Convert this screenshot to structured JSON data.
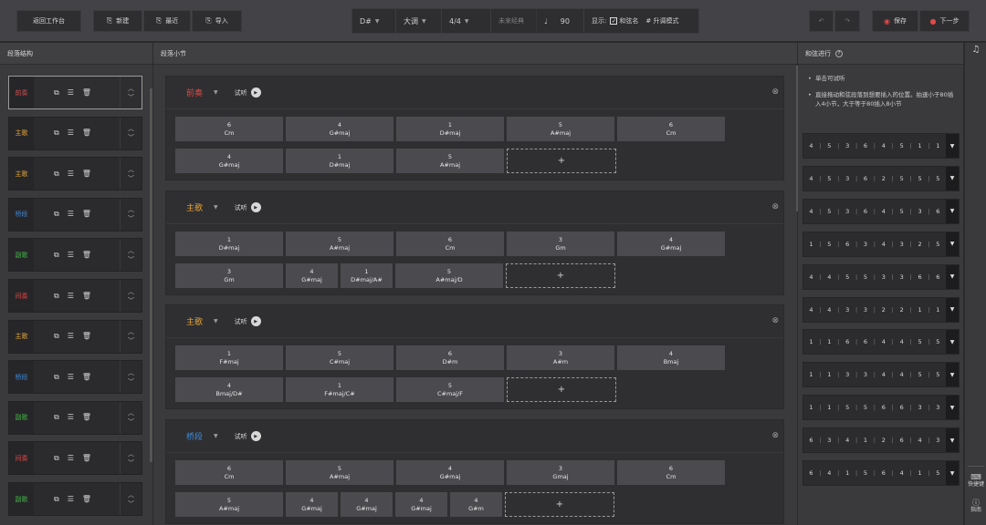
{
  "toolbar": {
    "back": "返回工作台",
    "new": "新建",
    "recent": "最近",
    "import": "导入",
    "key": "D#",
    "mode": "大调",
    "meter": "4/4",
    "rhythm": "未来经典",
    "note_icon": "♩",
    "bpm": "90",
    "show_label": "显示:",
    "chord_name": "和弦名",
    "sharp_mode": "# 升调模式",
    "save": "保存",
    "next": "下一步",
    "save_color": "#e04848"
  },
  "left_panel": {
    "title": "段落结构",
    "items": [
      {
        "name": "前奏",
        "color": "#e04848"
      },
      {
        "name": "主歌",
        "color": "#e6a53b"
      },
      {
        "name": "主歌",
        "color": "#e6a53b"
      },
      {
        "name": "桥段",
        "color": "#3f8ad8"
      },
      {
        "name": "副歌",
        "color": "#47b34a"
      },
      {
        "name": "间奏",
        "color": "#e04848"
      },
      {
        "name": "主歌",
        "color": "#e6a53b"
      },
      {
        "name": "桥段",
        "color": "#3f8ad8"
      },
      {
        "name": "副歌",
        "color": "#47b34a"
      },
      {
        "name": "间奏",
        "color": "#e04848"
      },
      {
        "name": "副歌",
        "color": "#47b34a"
      }
    ]
  },
  "middle_panel": {
    "title": "段落小节",
    "listen": "试听",
    "add": "+",
    "sections": [
      {
        "name": "前奏",
        "color": "#e04848",
        "rows": [
          [
            {
              "d": "6",
              "c": "Cm"
            },
            {
              "d": "4",
              "c": "G#maj"
            },
            {
              "d": "1",
              "c": "D#maj"
            },
            {
              "d": "5",
              "c": "A#maj"
            },
            {
              "d": "6",
              "c": "Cm"
            }
          ],
          [
            {
              "d": "4",
              "c": "G#maj"
            },
            {
              "d": "1",
              "c": "D#maj"
            },
            {
              "d": "5",
              "c": "A#maj"
            }
          ]
        ]
      },
      {
        "name": "主歌",
        "color": "#e6a53b",
        "rows": [
          [
            {
              "d": "1",
              "c": "D#maj"
            },
            {
              "d": "5",
              "c": "A#maj"
            },
            {
              "d": "6",
              "c": "Cm"
            },
            {
              "d": "3",
              "c": "Gm"
            },
            {
              "d": "4",
              "c": "G#maj"
            }
          ],
          [
            {
              "d": "3",
              "c": "Gm"
            },
            {
              "d": "4",
              "c": "G#maj",
              "half": true
            },
            {
              "d": "1",
              "c": "D#maj/A#",
              "half": true
            },
            {
              "d": "5",
              "c": "A#maj/D"
            }
          ]
        ]
      },
      {
        "name": "主歌",
        "color": "#e6a53b",
        "rows": [
          [
            {
              "d": "1",
              "c": "F#maj"
            },
            {
              "d": "5",
              "c": "C#maj"
            },
            {
              "d": "6",
              "c": "D#m"
            },
            {
              "d": "3",
              "c": "A#m"
            },
            {
              "d": "4",
              "c": "Bmaj"
            }
          ],
          [
            {
              "d": "4",
              "c": "Bmaj/D#"
            },
            {
              "d": "1",
              "c": "F#maj/C#"
            },
            {
              "d": "5",
              "c": "C#maj/F"
            }
          ]
        ]
      },
      {
        "name": "桥段",
        "color": "#3f8ad8",
        "rows": [
          [
            {
              "d": "6",
              "c": "Cm"
            },
            {
              "d": "5",
              "c": "A#maj"
            },
            {
              "d": "4",
              "c": "G#maj"
            },
            {
              "d": "3",
              "c": "Gmaj"
            },
            {
              "d": "6",
              "c": "Cm"
            }
          ],
          [
            {
              "d": "5",
              "c": "A#maj"
            },
            {
              "d": "4",
              "c": "G#maj",
              "half": true
            },
            {
              "d": "4",
              "c": "G#maj",
              "half": true
            },
            {
              "d": "4",
              "c": "G#maj",
              "half": true
            },
            {
              "d": "4",
              "c": "G#m",
              "half": true
            }
          ]
        ]
      }
    ]
  },
  "right_panel": {
    "title": "和弦进行",
    "help_icon": "?",
    "notes": [
      "单击可试听",
      "直接拖动和弦段落到想要插入的位置。拍速小于80插入4小节，大于等于80插入8小节"
    ],
    "progressions": [
      [
        "4",
        "5",
        "3",
        "6",
        "4",
        "5",
        "1",
        "1"
      ],
      [
        "4",
        "5",
        "3",
        "6",
        "2",
        "5",
        "5",
        "5"
      ],
      [
        "4",
        "5",
        "3",
        "6",
        "4",
        "5",
        "3",
        "6"
      ],
      [
        "1",
        "5",
        "6",
        "3",
        "4",
        "3",
        "2",
        "5"
      ],
      [
        "4",
        "4",
        "5",
        "5",
        "3",
        "3",
        "6",
        "6"
      ],
      [
        "4",
        "4",
        "3",
        "3",
        "2",
        "2",
        "1",
        "1"
      ],
      [
        "1",
        "1",
        "6",
        "6",
        "4",
        "4",
        "5",
        "5"
      ],
      [
        "1",
        "1",
        "3",
        "3",
        "4",
        "4",
        "5",
        "5"
      ],
      [
        "1",
        "1",
        "5",
        "5",
        "6",
        "6",
        "3",
        "3"
      ],
      [
        "6",
        "3",
        "4",
        "1",
        "2",
        "6",
        "4",
        "3"
      ],
      [
        "6",
        "4",
        "1",
        "5",
        "6",
        "4",
        "1",
        "5"
      ]
    ]
  },
  "sidebar": {
    "shortcut": "快捷键",
    "guide": "指南"
  }
}
